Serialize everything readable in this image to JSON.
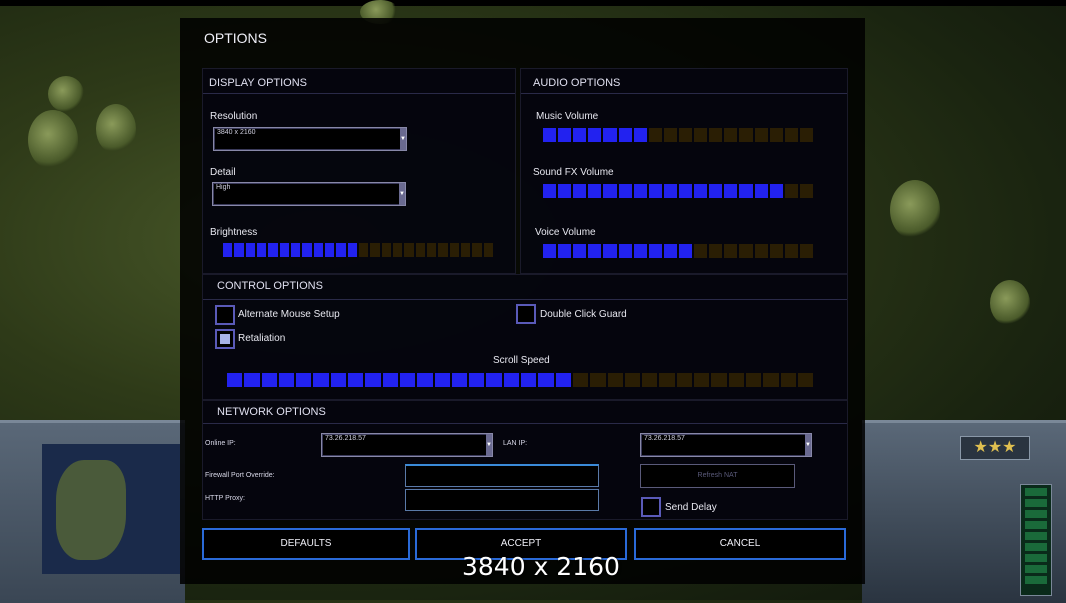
{
  "window": {
    "title": "OPTIONS"
  },
  "display": {
    "header": "DISPLAY OPTIONS",
    "resolution_label": "Resolution",
    "resolution_value": "3840 x 2160",
    "detail_label": "Detail",
    "detail_value": "High",
    "brightness_label": "Brightness",
    "brightness_level": 0.5
  },
  "audio": {
    "header": "AUDIO OPTIONS",
    "music_label": "Music Volume",
    "music_level": 0.39,
    "sfx_label": "Sound FX Volume",
    "sfx_level": 0.89,
    "voice_label": "Voice Volume",
    "voice_level": 0.56
  },
  "control": {
    "header": "CONTROL OPTIONS",
    "alt_mouse_label": "Alternate Mouse Setup",
    "alt_mouse_checked": false,
    "double_click_label": "Double Click Guard",
    "double_click_checked": false,
    "retaliation_label": "Retaliation",
    "retaliation_checked": true,
    "scroll_label": "Scroll Speed",
    "scroll_level": 0.59
  },
  "network": {
    "header": "NETWORK OPTIONS",
    "online_ip_label": "Online IP:",
    "online_ip_value": "73.26.218.57",
    "lan_ip_label": "LAN IP:",
    "lan_ip_value": "73.26.218.57",
    "firewall_label": "Firewall Port Override:",
    "firewall_value": "",
    "proxy_label": "HTTP Proxy:",
    "proxy_value": "",
    "refresh_nat_label": "Refresh NAT",
    "send_delay_label": "Send Delay",
    "send_delay_checked": false
  },
  "buttons": {
    "defaults": "DEFAULTS",
    "accept": "ACCEPT",
    "cancel": "CANCEL"
  },
  "overlay_resolution": "3840 x 2160",
  "hud": {
    "rank_stars": "★★★"
  },
  "colors": {
    "slider_on": "#2222f0",
    "slider_off": "#2a1e04",
    "accent_border": "#2a6ad8"
  }
}
